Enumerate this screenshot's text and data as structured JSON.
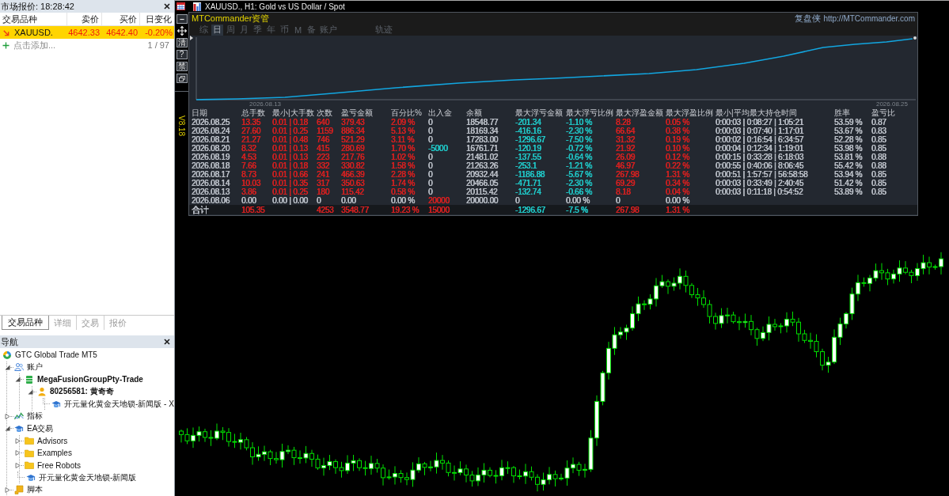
{
  "market_watch": {
    "title": "市场报价: 18:28:42",
    "columns": [
      "交易品种",
      "卖价",
      "买价",
      "日变化"
    ],
    "rows": [
      {
        "symbol": "XAUUSD.",
        "bid": "4642.33",
        "ask": "4642.40",
        "change": "-0.20%",
        "falling": true,
        "selected": true
      }
    ],
    "add_label": "点击添加...",
    "count": "1 / 97",
    "tabs": [
      {
        "label": "交易品种",
        "selected": true
      },
      {
        "label": "详细",
        "selected": false
      },
      {
        "label": "交易",
        "selected": false
      },
      {
        "label": "报价",
        "selected": false
      }
    ]
  },
  "chart_window": {
    "title": "XAUUSD., H1: Gold vs US Dollar / Spot",
    "toolbar": [
      {
        "kind": "minimize"
      },
      {
        "kind": "move"
      },
      {
        "kind": "text",
        "label": "清"
      },
      {
        "kind": "text",
        "label": "?"
      },
      {
        "kind": "text",
        "label": "禁"
      },
      {
        "kind": "restore"
      }
    ],
    "version": "V8.18",
    "panel": {
      "title": "MTCommander资管",
      "brand": "复盘侠",
      "url": "http://MTCommander.com",
      "tabs": [
        {
          "label": "综",
          "selected": false
        },
        {
          "label": "日",
          "selected": true
        },
        {
          "label": "周",
          "selected": false
        },
        {
          "label": "月",
          "selected": false
        },
        {
          "label": "季",
          "selected": false
        },
        {
          "label": "年",
          "selected": false
        },
        {
          "label": "币",
          "selected": false
        },
        {
          "label": "M",
          "selected": false
        },
        {
          "label": "备",
          "selected": false
        },
        {
          "label": "账户",
          "selected": false
        },
        {
          "label": "轨迹",
          "selected": false
        }
      ],
      "equity_chart": {
        "date_labels": [
          "2026.08.13",
          "2026.08.25"
        ]
      },
      "table": {
        "columns": [
          "日期",
          "总手数",
          "最小|大手数",
          "次数",
          "盈亏金额",
          "百分比%",
          "出入金",
          "余额",
          "最大浮亏金额",
          "最大浮亏比例",
          "最大浮盈金额",
          "最大浮盈比例",
          "最小|平均最大持仓时间",
          "胜率",
          "盈亏比"
        ],
        "rows": [
          {
            "cells": [
              {
                "text": "2026.08.25",
                "color": "#b8bdc5"
              },
              {
                "text": "13.35",
                "color": "#d42020"
              },
              {
                "text": "0.01 | 0.18",
                "color": "#d42020"
              },
              {
                "text": "640",
                "color": "#d42020"
              },
              {
                "text": "379.43",
                "color": "#d42020"
              },
              {
                "text": "2.09 %",
                "color": "#d42020"
              },
              {
                "text": "0",
                "color": "#b8bdc5"
              },
              {
                "text": "18548.77",
                "color": "#b8bdc5"
              },
              {
                "text": "-201.34",
                "color": "#20c4c4"
              },
              {
                "text": "-1.10 %",
                "color": "#20c4c4"
              },
              {
                "text": "8.28",
                "color": "#d42020"
              },
              {
                "text": "0.05 %",
                "color": "#d42020"
              },
              {
                "text": "0:00:03 | 0:08:27 | 1:05:21",
                "color": "#b8bdc5"
              },
              {
                "text": "53.59 %",
                "color": "#b8bdc5"
              },
              {
                "text": "0.87",
                "color": "#b8bdc5"
              }
            ]
          },
          {
            "cells": [
              {
                "text": "2026.08.24",
                "color": "#b8bdc5"
              },
              {
                "text": "27.60",
                "color": "#d42020"
              },
              {
                "text": "0.01 | 0.25",
                "color": "#d42020"
              },
              {
                "text": "1159",
                "color": "#d42020"
              },
              {
                "text": "886.34",
                "color": "#d42020"
              },
              {
                "text": "5.13 %",
                "color": "#d42020"
              },
              {
                "text": "0",
                "color": "#b8bdc5"
              },
              {
                "text": "18169.34",
                "color": "#b8bdc5"
              },
              {
                "text": "-416.16",
                "color": "#20c4c4"
              },
              {
                "text": "-2.30 %",
                "color": "#20c4c4"
              },
              {
                "text": "66.64",
                "color": "#d42020"
              },
              {
                "text": "0.38 %",
                "color": "#d42020"
              },
              {
                "text": "0:00:03 | 0:07:40 | 1:17:01",
                "color": "#b8bdc5"
              },
              {
                "text": "53.67 %",
                "color": "#b8bdc5"
              },
              {
                "text": "0.83",
                "color": "#b8bdc5"
              }
            ]
          },
          {
            "cells": [
              {
                "text": "2026.08.21",
                "color": "#b8bdc5"
              },
              {
                "text": "21.27",
                "color": "#d42020"
              },
              {
                "text": "0.01 | 0.48",
                "color": "#d42020"
              },
              {
                "text": "746",
                "color": "#d42020"
              },
              {
                "text": "521.29",
                "color": "#d42020"
              },
              {
                "text": "3.11 %",
                "color": "#d42020"
              },
              {
                "text": "0",
                "color": "#b8bdc5"
              },
              {
                "text": "17283.00",
                "color": "#b8bdc5"
              },
              {
                "text": "-1296.67",
                "color": "#20c4c4"
              },
              {
                "text": "-7.50 %",
                "color": "#20c4c4"
              },
              {
                "text": "31.32",
                "color": "#d42020"
              },
              {
                "text": "0.19 %",
                "color": "#d42020"
              },
              {
                "text": "0:00:02 | 0:16:54 | 6:34:57",
                "color": "#b8bdc5"
              },
              {
                "text": "52.28 %",
                "color": "#b8bdc5"
              },
              {
                "text": "0.85",
                "color": "#b8bdc5"
              }
            ]
          },
          {
            "cells": [
              {
                "text": "2026.08.20",
                "color": "#b8bdc5"
              },
              {
                "text": "8.32",
                "color": "#d42020"
              },
              {
                "text": "0.01 | 0.13",
                "color": "#d42020"
              },
              {
                "text": "415",
                "color": "#d42020"
              },
              {
                "text": "280.69",
                "color": "#d42020"
              },
              {
                "text": "1.70 %",
                "color": "#d42020"
              },
              {
                "text": "-5000",
                "color": "#20c4c4"
              },
              {
                "text": "16761.71",
                "color": "#b8bdc5"
              },
              {
                "text": "-120.19",
                "color": "#20c4c4"
              },
              {
                "text": "-0.72 %",
                "color": "#20c4c4"
              },
              {
                "text": "21.92",
                "color": "#d42020"
              },
              {
                "text": "0.10 %",
                "color": "#d42020"
              },
              {
                "text": "0:00:04 | 0:12:34 | 1:19:01",
                "color": "#b8bdc5"
              },
              {
                "text": "53.98 %",
                "color": "#b8bdc5"
              },
              {
                "text": "0.85",
                "color": "#b8bdc5"
              }
            ]
          },
          {
            "cells": [
              {
                "text": "2026.08.19",
                "color": "#b8bdc5"
              },
              {
                "text": "4.53",
                "color": "#d42020"
              },
              {
                "text": "0.01 | 0.13",
                "color": "#d42020"
              },
              {
                "text": "223",
                "color": "#d42020"
              },
              {
                "text": "217.76",
                "color": "#d42020"
              },
              {
                "text": "1.02 %",
                "color": "#d42020"
              },
              {
                "text": "0",
                "color": "#b8bdc5"
              },
              {
                "text": "21481.02",
                "color": "#b8bdc5"
              },
              {
                "text": "-137.55",
                "color": "#20c4c4"
              },
              {
                "text": "-0.64 %",
                "color": "#20c4c4"
              },
              {
                "text": "26.09",
                "color": "#d42020"
              },
              {
                "text": "0.12 %",
                "color": "#d42020"
              },
              {
                "text": "0:00:15 | 0:33:28 | 6:18:03",
                "color": "#b8bdc5"
              },
              {
                "text": "53.81 %",
                "color": "#b8bdc5"
              },
              {
                "text": "0.88",
                "color": "#b8bdc5"
              }
            ]
          },
          {
            "cells": [
              {
                "text": "2026.08.18",
                "color": "#b8bdc5"
              },
              {
                "text": "7.66",
                "color": "#d42020"
              },
              {
                "text": "0.01 | 0.18",
                "color": "#d42020"
              },
              {
                "text": "332",
                "color": "#d42020"
              },
              {
                "text": "330.82",
                "color": "#d42020"
              },
              {
                "text": "1.58 %",
                "color": "#d42020"
              },
              {
                "text": "0",
                "color": "#b8bdc5"
              },
              {
                "text": "21263.26",
                "color": "#b8bdc5"
              },
              {
                "text": "-253.1",
                "color": "#20c4c4"
              },
              {
                "text": "-1.21 %",
                "color": "#20c4c4"
              },
              {
                "text": "46.97",
                "color": "#d42020"
              },
              {
                "text": "0.22 %",
                "color": "#d42020"
              },
              {
                "text": "0:00:55 | 0:40:06 | 8:06:45",
                "color": "#b8bdc5"
              },
              {
                "text": "55.42 %",
                "color": "#b8bdc5"
              },
              {
                "text": "0.88",
                "color": "#b8bdc5"
              }
            ]
          },
          {
            "cells": [
              {
                "text": "2026.08.17",
                "color": "#b8bdc5"
              },
              {
                "text": "8.73",
                "color": "#d42020"
              },
              {
                "text": "0.01 | 0.66",
                "color": "#d42020"
              },
              {
                "text": "241",
                "color": "#d42020"
              },
              {
                "text": "466.39",
                "color": "#d42020"
              },
              {
                "text": "2.28 %",
                "color": "#d42020"
              },
              {
                "text": "0",
                "color": "#b8bdc5"
              },
              {
                "text": "20932.44",
                "color": "#b8bdc5"
              },
              {
                "text": "-1186.88",
                "color": "#20c4c4"
              },
              {
                "text": "-5.67 %",
                "color": "#20c4c4"
              },
              {
                "text": "267.98",
                "color": "#d42020"
              },
              {
                "text": "1.31 %",
                "color": "#d42020"
              },
              {
                "text": "0:00:51 | 1:57:57 | 56:58:58",
                "color": "#b8bdc5"
              },
              {
                "text": "53.94 %",
                "color": "#b8bdc5"
              },
              {
                "text": "0.85",
                "color": "#b8bdc5"
              }
            ]
          },
          {
            "cells": [
              {
                "text": "2026.08.14",
                "color": "#b8bdc5"
              },
              {
                "text": "10.03",
                "color": "#d42020"
              },
              {
                "text": "0.01 | 0.35",
                "color": "#d42020"
              },
              {
                "text": "317",
                "color": "#d42020"
              },
              {
                "text": "350.63",
                "color": "#d42020"
              },
              {
                "text": "1.74 %",
                "color": "#d42020"
              },
              {
                "text": "0",
                "color": "#b8bdc5"
              },
              {
                "text": "20466.05",
                "color": "#b8bdc5"
              },
              {
                "text": "-471.71",
                "color": "#20c4c4"
              },
              {
                "text": "-2.30 %",
                "color": "#20c4c4"
              },
              {
                "text": "69.29",
                "color": "#d42020"
              },
              {
                "text": "0.34 %",
                "color": "#d42020"
              },
              {
                "text": "0:00:03 | 0:33:49 | 2:40:45",
                "color": "#b8bdc5"
              },
              {
                "text": "51.42 %",
                "color": "#b8bdc5"
              },
              {
                "text": "0.85",
                "color": "#b8bdc5"
              }
            ]
          },
          {
            "cells": [
              {
                "text": "2026.08.13",
                "color": "#b8bdc5"
              },
              {
                "text": "3.86",
                "color": "#d42020"
              },
              {
                "text": "0.01 | 0.25",
                "color": "#d42020"
              },
              {
                "text": "180",
                "color": "#d42020"
              },
              {
                "text": "115.42",
                "color": "#d42020"
              },
              {
                "text": "0.58 %",
                "color": "#d42020"
              },
              {
                "text": "0",
                "color": "#b8bdc5"
              },
              {
                "text": "20115.42",
                "color": "#b8bdc5"
              },
              {
                "text": "-132.74",
                "color": "#20c4c4"
              },
              {
                "text": "-0.66 %",
                "color": "#20c4c4"
              },
              {
                "text": "8.18",
                "color": "#d42020"
              },
              {
                "text": "0.04 %",
                "color": "#d42020"
              },
              {
                "text": "0:00:03 | 0:11:18 | 0:54:52",
                "color": "#b8bdc5"
              },
              {
                "text": "53.89 %",
                "color": "#b8bdc5"
              },
              {
                "text": "0.85",
                "color": "#b8bdc5"
              }
            ]
          },
          {
            "cells": [
              {
                "text": "2026.08.06",
                "color": "#b8bdc5"
              },
              {
                "text": "0.00",
                "color": "#b8bdc5"
              },
              {
                "text": "0.00 | 0.00",
                "color": "#b8bdc5"
              },
              {
                "text": "0",
                "color": "#b8bdc5"
              },
              {
                "text": "0.00",
                "color": "#b8bdc5"
              },
              {
                "text": "0.00 %",
                "color": "#b8bdc5"
              },
              {
                "text": "20000",
                "color": "#d42020"
              },
              {
                "text": "20000.00",
                "color": "#b8bdc5"
              },
              {
                "text": "0",
                "color": "#b8bdc5"
              },
              {
                "text": "0.00 %",
                "color": "#b8bdc5"
              },
              {
                "text": "0",
                "color": "#b8bdc5"
              },
              {
                "text": "0.00 %",
                "color": "#b8bdc5"
              }
            ]
          }
        ],
        "total": {
          "cells": [
            {
              "text": "合计",
              "color": "#b8bdc5"
            },
            {
              "text": "105.35",
              "color": "#d42020"
            },
            null,
            {
              "text": "4253",
              "color": "#d42020"
            },
            {
              "text": "3548.77",
              "color": "#d42020"
            },
            {
              "text": "19.23 %",
              "color": "#d42020"
            },
            {
              "text": "15000",
              "color": "#d42020"
            },
            null,
            {
              "text": "-1296.67",
              "color": "#20c4c4"
            },
            {
              "text": "-7.5 %",
              "color": "#20c4c4"
            },
            {
              "text": "267.98",
              "color": "#d42020"
            },
            {
              "text": "1.31 %",
              "color": "#d42020"
            }
          ]
        }
      }
    }
  },
  "navigator": {
    "title": "导航",
    "tree": [
      {
        "label": "GTC Global Trade MT5",
        "kind": "broker",
        "children": [
          {
            "label": "账户",
            "kind": "accounts",
            "expanded": true,
            "children": [
              {
                "label": "MegaFusionGroupPty-Trade",
                "kind": "server",
                "expanded": true,
                "children": [
                  {
                    "label": "80256581: 黄奇奇",
                    "kind": "account",
                    "expanded": true,
                    "children": [
                      {
                        "label": "开元量化黄金天地锁-新闻版 - X",
                        "kind": "expert"
                      }
                    ]
                  }
                ]
              }
            ]
          },
          {
            "label": "指标",
            "kind": "indicators",
            "expanded": false
          },
          {
            "label": "EA交易",
            "kind": "experts",
            "expanded": true,
            "children": [
              {
                "label": "Advisors",
                "kind": "folder",
                "expanded": false
              },
              {
                "label": "Examples",
                "kind": "folder",
                "expanded": false
              },
              {
                "label": "Free Robots",
                "kind": "folder",
                "expanded": false
              },
              {
                "label": "开元量化黄金天地锁-新闻版",
                "kind": "expert"
              }
            ]
          },
          {
            "label": "脚本",
            "kind": "scripts",
            "expanded": false
          }
        ]
      }
    ]
  }
}
